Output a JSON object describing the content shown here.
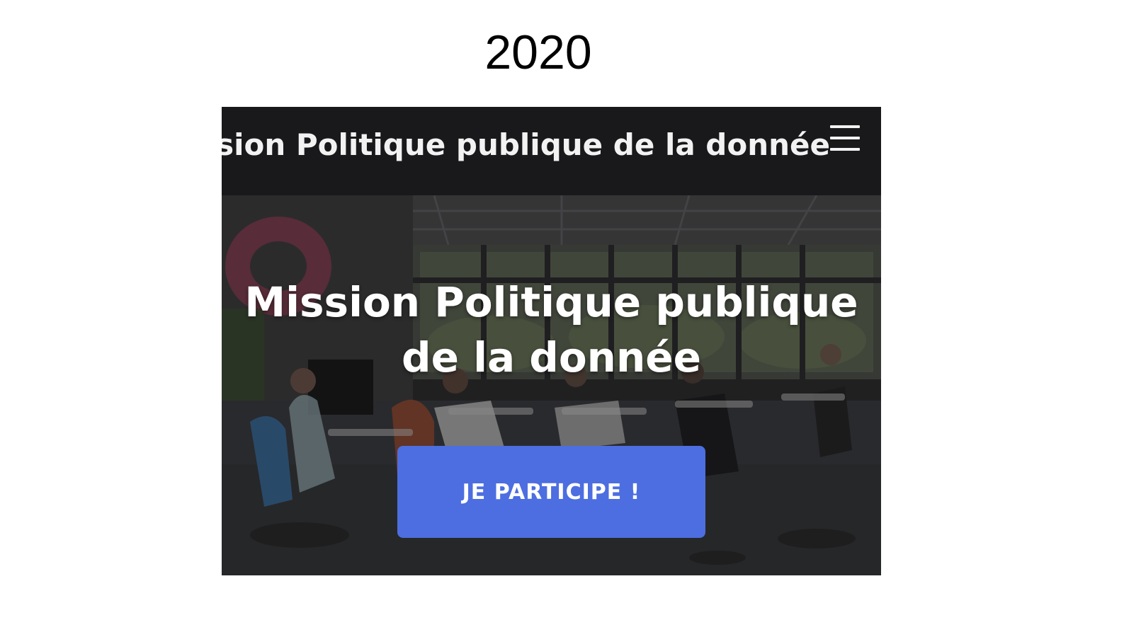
{
  "slide": {
    "year": "2020"
  },
  "site": {
    "header_title": "Mission Politique publique de la donnée",
    "menu_icon": "hamburger-menu-icon",
    "hero_title": "Mission Politique publique de la donnée",
    "cta_label": "JE PARTICIPE !"
  },
  "colors": {
    "header_bg": "#19181b",
    "cta_bg": "#4d6ee0",
    "text_light": "#ffffff"
  }
}
